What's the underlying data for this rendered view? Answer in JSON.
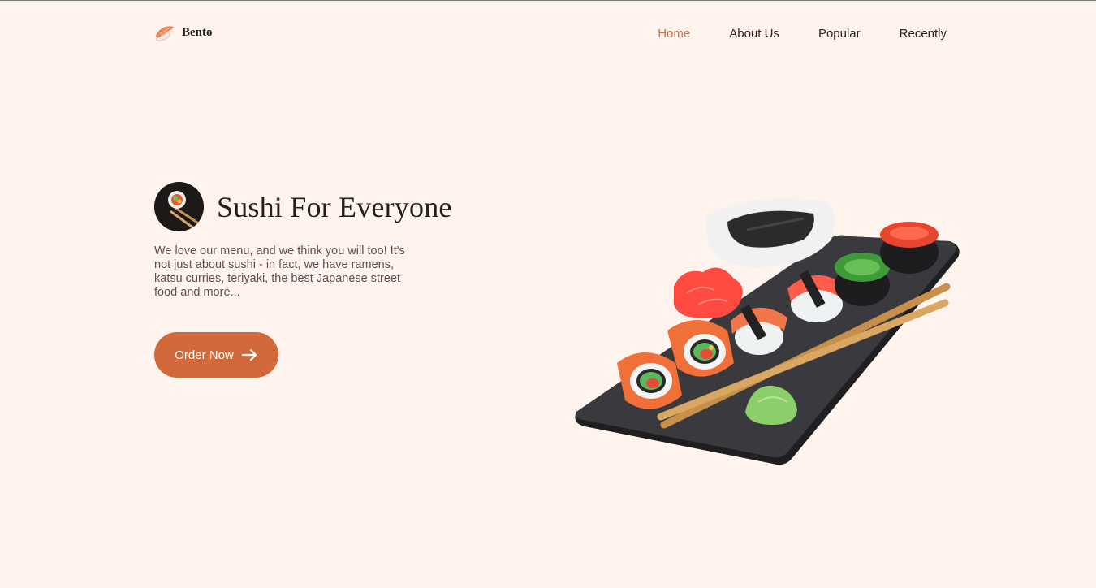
{
  "header": {
    "brand": "Bento",
    "nav": [
      {
        "label": "Home",
        "active": true
      },
      {
        "label": "About Us",
        "active": false
      },
      {
        "label": "Popular",
        "active": false
      },
      {
        "label": "Recently",
        "active": false
      }
    ]
  },
  "hero": {
    "title": "Sushi For Everyone",
    "description": "We love our menu, and we think you will too! It's not just about sushi - in fact, we have ramens, katsu curries, teriyaki, the best Japanese street food and more...",
    "cta_label": "Order Now"
  },
  "colors": {
    "background": "#fff3ee",
    "accent": "#d2693a",
    "nav_active": "#c9714a",
    "text": "#2b2320"
  },
  "icons": {
    "logo": "sushi-nigiri-icon",
    "badge": "sushi-roll-chopsticks-icon",
    "cta": "arrow-right-icon"
  }
}
